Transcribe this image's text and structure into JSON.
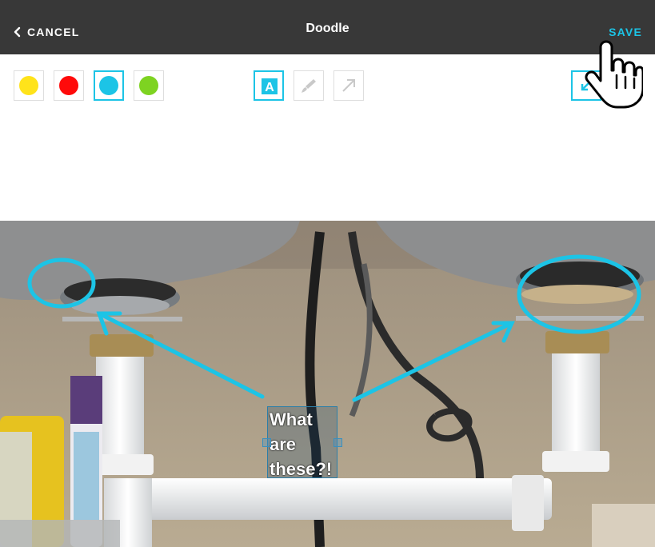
{
  "header": {
    "cancel_label": "CANCEL",
    "title": "Doodle",
    "save_label": "SAVE"
  },
  "toolbar": {
    "colors": [
      {
        "name": "yellow",
        "hex": "#ffe31a",
        "selected": false
      },
      {
        "name": "red",
        "hex": "#ff0a0a",
        "selected": false
      },
      {
        "name": "blue",
        "hex": "#1cc4e6",
        "selected": true
      },
      {
        "name": "green",
        "hex": "#7ed321",
        "selected": false
      }
    ],
    "tools": [
      {
        "name": "text-tool",
        "icon": "text-a-icon",
        "glyph": "A",
        "selected": true
      },
      {
        "name": "brush-tool",
        "icon": "brush-icon",
        "selected": false
      },
      {
        "name": "arrow-tool",
        "icon": "arrow-icon",
        "selected": false
      }
    ],
    "extra_button_icon": "undo-icon"
  },
  "annotation": {
    "lines": [
      "What",
      "are",
      "these?!"
    ],
    "stroke_color": "#1cc4e6"
  },
  "theme": {
    "header_bg": "#383838",
    "accent": "#1cc4e6"
  }
}
